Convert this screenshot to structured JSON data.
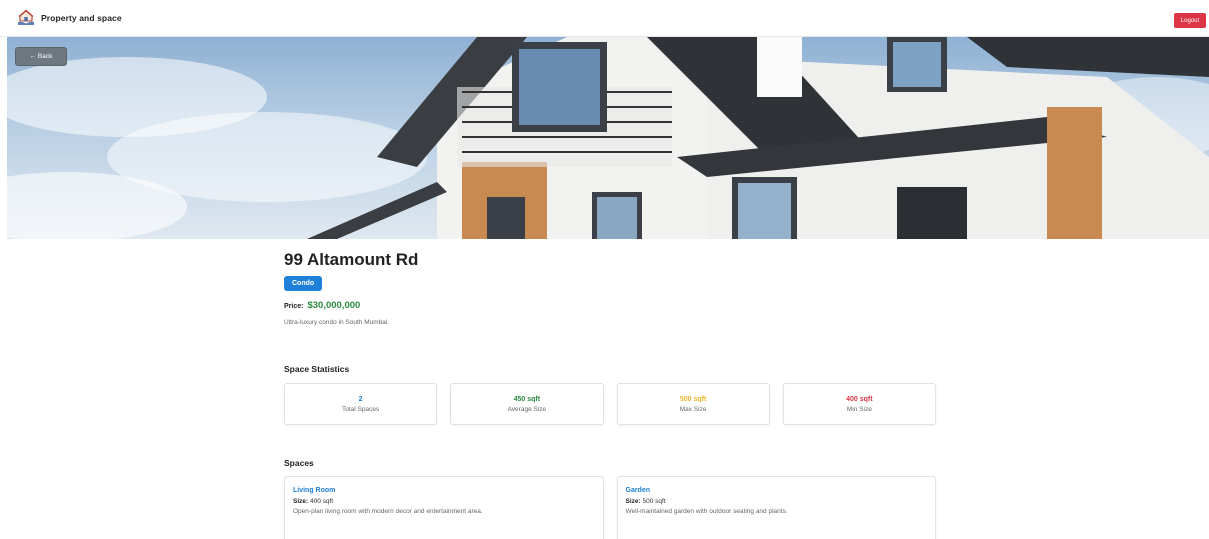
{
  "navbar": {
    "brand_title": "Property and space",
    "logout_label": "Logout",
    "logo_icon": "house-in-hands-icon"
  },
  "hero": {
    "back_label": "← Back",
    "image": "house-photo"
  },
  "property": {
    "title": "99 Altamount Rd",
    "type_badge": "Condo",
    "price_label": "Price:",
    "price_value": "$30,000,000",
    "description": "Ultra-luxury condo in South Mumbai."
  },
  "statistics": {
    "section_title": "Space Statistics",
    "cards": [
      {
        "value": "2",
        "label": "Total Spaces",
        "color": "#1e80d8"
      },
      {
        "value": "450 sqft",
        "label": "Average Size",
        "color": "#2a8a3e"
      },
      {
        "value": "500 sqft",
        "label": "Max Size",
        "color": "#f0b429"
      },
      {
        "value": "400 sqft",
        "label": "Min Size",
        "color": "#dc3545"
      }
    ]
  },
  "spaces": {
    "section_title": "Spaces",
    "size_label": "Size:",
    "items": [
      {
        "name": "Living Room",
        "size": "400 sqft",
        "description": "Open-plan living room with modern decor and entertainment area."
      },
      {
        "name": "Garden",
        "size": "500 sqft",
        "description": "Well-maintained garden with outdoor seating and plants."
      }
    ]
  },
  "colors": {
    "primary": "#1e80d8",
    "danger": "#dc3545",
    "success": "#2a8a3e",
    "warning": "#f0b429"
  }
}
